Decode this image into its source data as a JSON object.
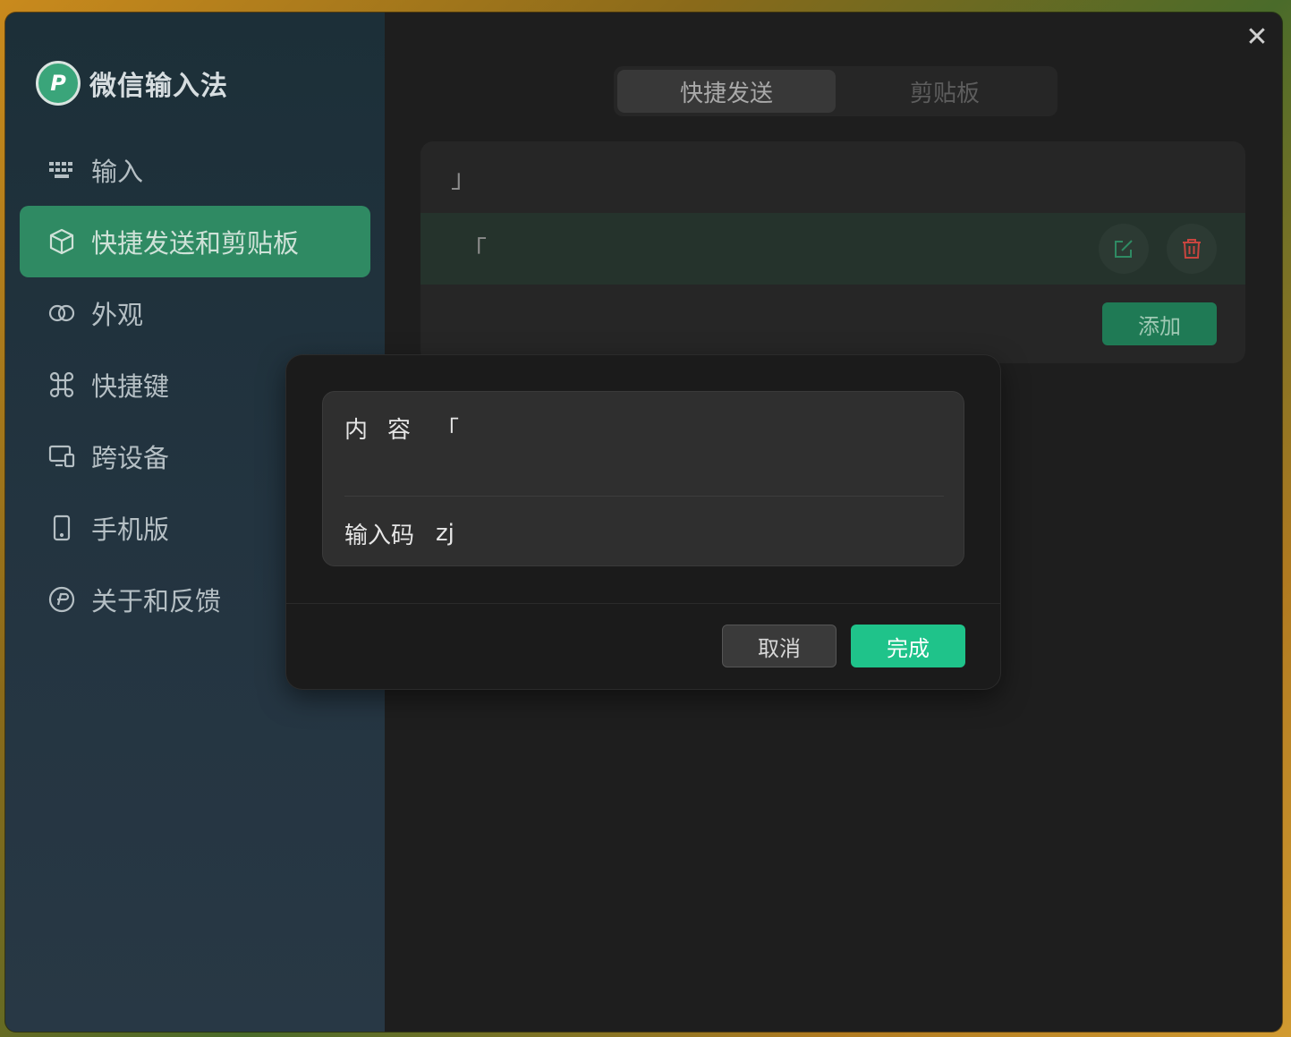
{
  "app": {
    "title": "微信输入法"
  },
  "sidebar": {
    "items": [
      {
        "label": "输入",
        "icon": "keyboard-icon",
        "active": false
      },
      {
        "label": "快捷发送和剪贴板",
        "icon": "cube-icon",
        "active": true
      },
      {
        "label": "外观",
        "icon": "appearance-icon",
        "active": false
      },
      {
        "label": "快捷键",
        "icon": "command-icon",
        "active": false
      },
      {
        "label": "跨设备",
        "icon": "devices-icon",
        "active": false
      },
      {
        "label": "手机版",
        "icon": "phone-icon",
        "active": false
      },
      {
        "label": "关于和反馈",
        "icon": "info-logo-icon",
        "active": false
      }
    ]
  },
  "tabs": [
    {
      "label": "快捷发送",
      "active": true
    },
    {
      "label": "剪贴板",
      "active": false
    }
  ],
  "list": {
    "rows": [
      {
        "text": "」",
        "selected": false
      },
      {
        "text": "「",
        "selected": true
      }
    ],
    "add_label": "添加"
  },
  "dialog": {
    "content_label": "内容",
    "content_value": "「",
    "code_label": "输入码",
    "code_value": "zj",
    "cancel_label": "取消",
    "done_label": "完成"
  },
  "colors": {
    "accent": "#1fc38a",
    "active_nav": "#2f8a63",
    "delete": "#c8453f"
  }
}
